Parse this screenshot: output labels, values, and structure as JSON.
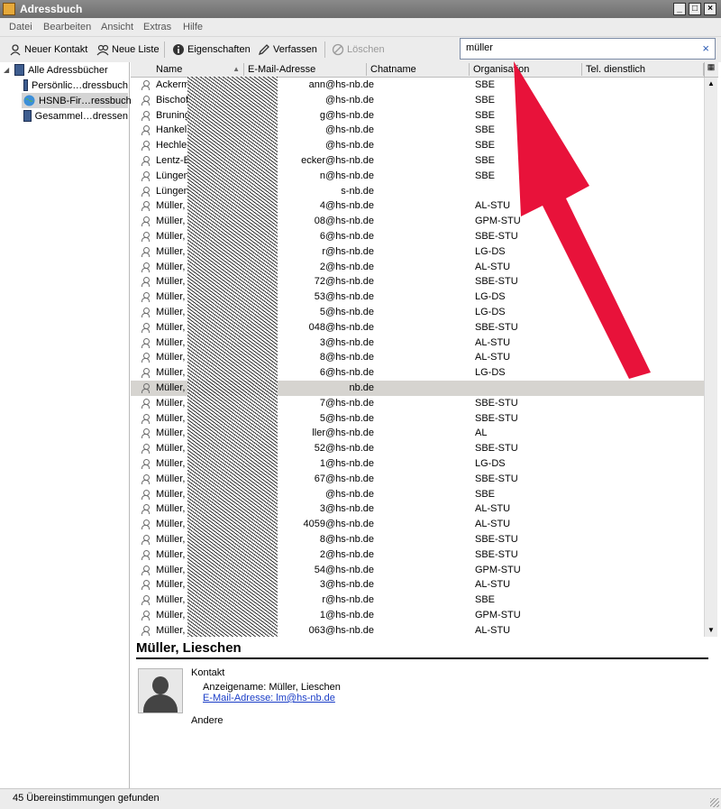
{
  "window": {
    "title": "Adressbuch",
    "controls": [
      "_",
      "□",
      "×"
    ]
  },
  "menu": [
    {
      "label": "Datei"
    },
    {
      "label": "Bearbeiten"
    },
    {
      "label": "Ansicht"
    },
    {
      "label": "Extras"
    },
    {
      "label": "Hilfe"
    }
  ],
  "toolbar": {
    "new_contact": "Neuer Kontakt",
    "new_list": "Neue Liste",
    "properties": "Eigenschaften",
    "compose": "Verfassen",
    "delete": "Löschen"
  },
  "search": {
    "value": "müller",
    "clear": "×"
  },
  "sidebar": {
    "root": "Alle Adressbücher",
    "books": [
      "Persönlic…dressbuch",
      "HSNB-Fir…ressbuch",
      "Gesammel…dressen"
    ]
  },
  "columns": [
    "Name",
    "E-Mail-Adresse",
    "Chatname",
    "Organisation",
    "Tel. dienstlich"
  ],
  "contacts": [
    {
      "name": "Ackerm",
      "email": "ann@hs-nb.de",
      "org": "SBE"
    },
    {
      "name": "Bischof",
      "email": "@hs-nb.de",
      "org": "SBE"
    },
    {
      "name": "Bruning",
      "email": "g@hs-nb.de",
      "org": "SBE"
    },
    {
      "name": "Hankel",
      "email": "@hs-nb.de",
      "org": "SBE"
    },
    {
      "name": "Hechler",
      "email": "@hs-nb.de",
      "org": "SBE"
    },
    {
      "name": "Lentz-B",
      "email": "ecker@hs-nb.de",
      "org": "SBE"
    },
    {
      "name": "Lüngen",
      "email": "n@hs-nb.de",
      "org": "SBE"
    },
    {
      "name": "Lüngen",
      "email": "s-nb.de",
      "org": ""
    },
    {
      "name": "Müller,",
      "email": "4@hs-nb.de",
      "org": "AL-STU"
    },
    {
      "name": "Müller,",
      "email": "08@hs-nb.de",
      "org": "GPM-STU"
    },
    {
      "name": "Müller,",
      "email": "6@hs-nb.de",
      "org": "SBE-STU"
    },
    {
      "name": "Müller,",
      "email": "r@hs-nb.de",
      "org": "LG-DS"
    },
    {
      "name": "Müller,",
      "email": "2@hs-nb.de",
      "org": "AL-STU"
    },
    {
      "name": "Müller,",
      "email": "72@hs-nb.de",
      "org": "SBE-STU"
    },
    {
      "name": "Müller,",
      "email": "53@hs-nb.de",
      "org": "LG-DS"
    },
    {
      "name": "Müller,",
      "email": "5@hs-nb.de",
      "org": "LG-DS"
    },
    {
      "name": "Müller,",
      "email": "048@hs-nb.de",
      "org": "SBE-STU"
    },
    {
      "name": "Müller,",
      "email": "3@hs-nb.de",
      "org": "AL-STU"
    },
    {
      "name": "Müller,",
      "email": "8@hs-nb.de",
      "org": "AL-STU"
    },
    {
      "name": "Müller,",
      "email": "6@hs-nb.de",
      "org": "LG-DS"
    },
    {
      "name": "Müller,",
      "email": "nb.de",
      "org": "",
      "selected": true
    },
    {
      "name": "Müller,",
      "email": "7@hs-nb.de",
      "org": "SBE-STU"
    },
    {
      "name": "Müller,",
      "email": "5@hs-nb.de",
      "org": "SBE-STU"
    },
    {
      "name": "Müller,",
      "email": "ller@hs-nb.de",
      "org": "AL"
    },
    {
      "name": "Müller,",
      "email": "52@hs-nb.de",
      "org": "SBE-STU"
    },
    {
      "name": "Müller,",
      "email": "1@hs-nb.de",
      "org": "LG-DS"
    },
    {
      "name": "Müller,",
      "email": "67@hs-nb.de",
      "org": "SBE-STU"
    },
    {
      "name": "Müller,",
      "email": "@hs-nb.de",
      "org": "SBE"
    },
    {
      "name": "Müller,",
      "email": "3@hs-nb.de",
      "org": "AL-STU"
    },
    {
      "name": "Müller,",
      "email": "4059@hs-nb.de",
      "org": "AL-STU"
    },
    {
      "name": "Müller,",
      "email": "8@hs-nb.de",
      "org": "SBE-STU"
    },
    {
      "name": "Müller,",
      "email": "2@hs-nb.de",
      "org": "SBE-STU"
    },
    {
      "name": "Müller,",
      "email": "54@hs-nb.de",
      "org": "GPM-STU"
    },
    {
      "name": "Müller,",
      "email": "3@hs-nb.de",
      "org": "AL-STU"
    },
    {
      "name": "Müller,",
      "email": "r@hs-nb.de",
      "org": "SBE"
    },
    {
      "name": "Müller,",
      "email": "1@hs-nb.de",
      "org": "GPM-STU"
    },
    {
      "name": "Müller,",
      "email": "063@hs-nb.de",
      "org": "AL-STU"
    }
  ],
  "detail": {
    "name": "Müller, Lieschen",
    "section": "Kontakt",
    "display_name": "Anzeigename: Müller, Lieschen",
    "email_link": "E-Mail-Adresse: lm@hs-nb.de",
    "other": "Andere"
  },
  "status": "45 Übereinstimmungen gefunden",
  "colors": {
    "arrow": "#e8123a",
    "titlebar": "#7c7c7c",
    "selection": "#d6d4d0"
  }
}
